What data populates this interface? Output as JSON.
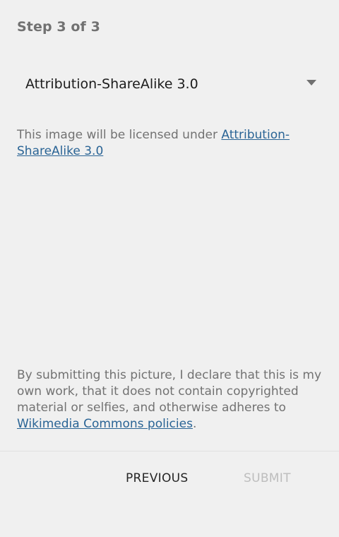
{
  "header": {
    "step_label": "Step 3 of 3"
  },
  "license_select": {
    "selected": "Attribution-ShareAlike 3.0"
  },
  "license_info": {
    "prefix": "This image will be licensed under ",
    "link_text": "Attribution-ShareAlike 3.0"
  },
  "declaration": {
    "text": "By submitting this picture, I declare that this is my own work, that it does not contain copyrighted material or selfies, and otherwise adheres to ",
    "link_text": "Wikimedia Commons policies",
    "suffix": "."
  },
  "footer": {
    "previous_label": "PREVIOUS",
    "submit_label": "SUBMIT"
  },
  "colors": {
    "background": "#f0f0f0",
    "link": "#2a6495",
    "disabled_text": "#bdbdbd"
  }
}
